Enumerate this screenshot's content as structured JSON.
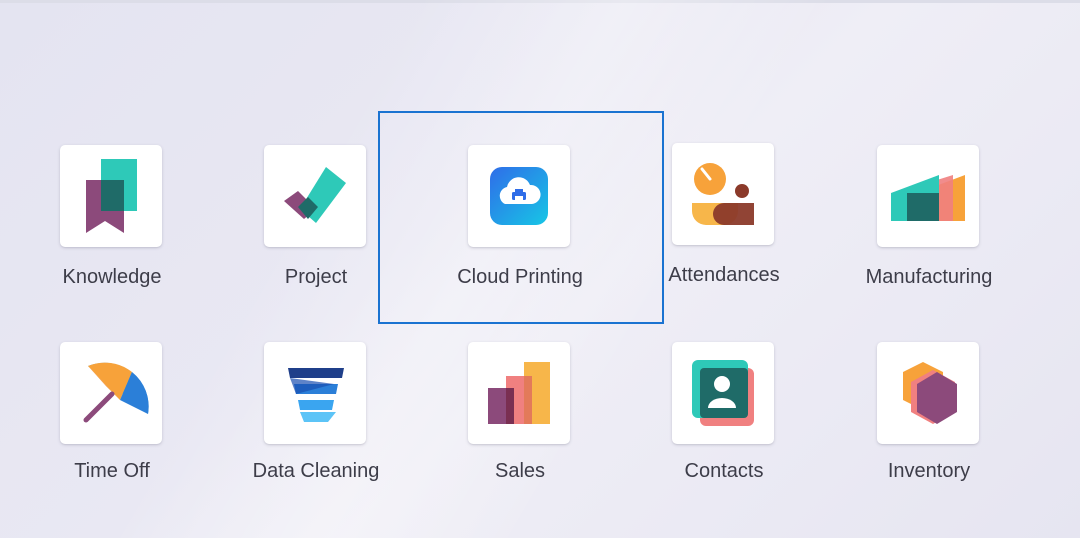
{
  "apps": [
    {
      "id": "knowledge",
      "label": "Knowledge",
      "icon": "knowledge-icon"
    },
    {
      "id": "project",
      "label": "Project",
      "icon": "project-icon"
    },
    {
      "id": "cloud-printing",
      "label": "Cloud Printing",
      "icon": "cloud-printing-icon",
      "selected": true
    },
    {
      "id": "attendances",
      "label": "Attendances",
      "icon": "attendances-icon"
    },
    {
      "id": "manufacturing",
      "label": "Manufacturing",
      "icon": "manufacturing-icon"
    },
    {
      "id": "time-off",
      "label": "Time Off",
      "icon": "time-off-icon"
    },
    {
      "id": "data-cleaning",
      "label": "Data Cleaning",
      "icon": "data-cleaning-icon"
    },
    {
      "id": "sales",
      "label": "Sales",
      "icon": "sales-icon"
    },
    {
      "id": "contacts",
      "label": "Contacts",
      "icon": "contacts-icon"
    },
    {
      "id": "inventory",
      "label": "Inventory",
      "icon": "inventory-icon"
    }
  ],
  "colors": {
    "selection_border": "#1a73d1",
    "teal": "#2ec9b8",
    "purple": "#8c4a7b",
    "orange": "#f7a23a",
    "blue": "#3aa5f0"
  }
}
